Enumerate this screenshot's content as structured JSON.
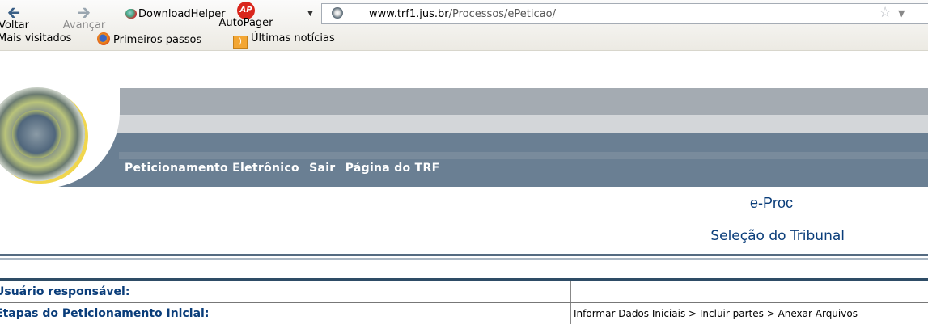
{
  "browser": {
    "back_label": "Voltar",
    "forward_label": "Avançar",
    "downloadhelper_label": "DownloadHelper",
    "autopager_label": "AutoPager",
    "autopager_badge": "AP",
    "url_domain": "www.trf1.jus.br",
    "url_path": "/Processos/ePeticao/",
    "bookmarks": [
      "Mais visitados",
      "Primeiros passos",
      "Últimas notícias"
    ]
  },
  "header": {
    "menu": [
      "Peticionamento Eletrônico",
      "Sair",
      "Página do TRF"
    ],
    "colors": {
      "band_dark": "#6a7f93",
      "band_mid": "#a4abb2",
      "band_light": "#d3d6d9"
    }
  },
  "page": {
    "app_title": "e-Proc",
    "subtitle": "Seleção do Tribunal",
    "title_color": "#0a3d7a"
  },
  "info_table": {
    "rows": [
      {
        "label": "Usuário responsável:",
        "value": ""
      },
      {
        "label": "Etapas do Peticionamento Inicial:",
        "value": "Informar Dados Iniciais > Incluir partes > Anexar Arquivos"
      }
    ]
  }
}
